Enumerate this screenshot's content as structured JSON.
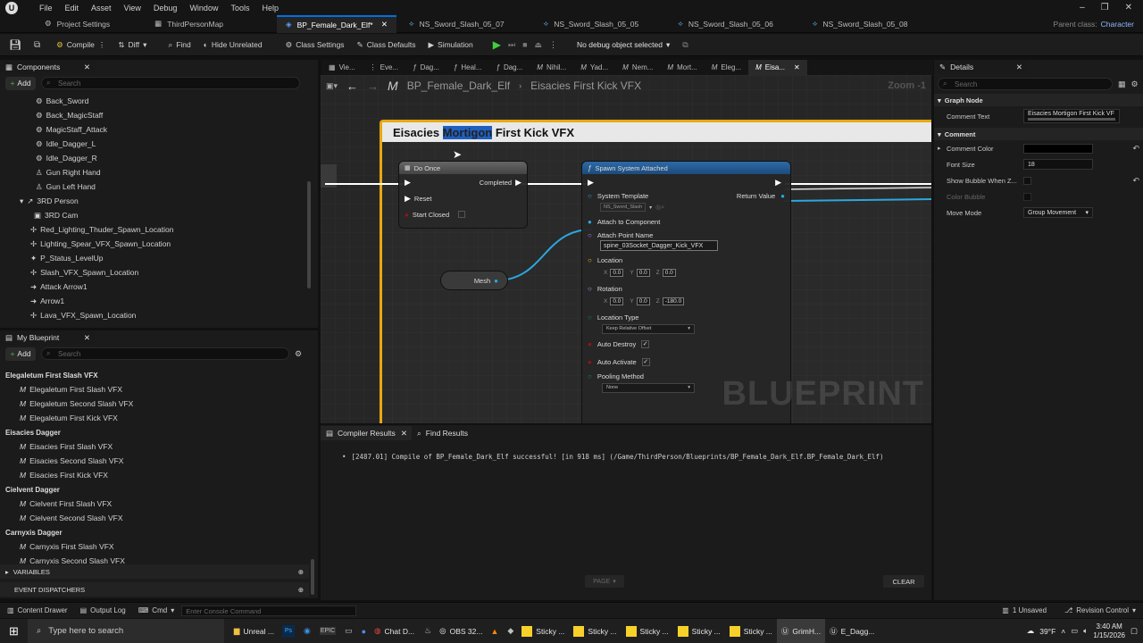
{
  "menu": [
    "File",
    "Edit",
    "Asset",
    "View",
    "Debug",
    "Window",
    "Tools",
    "Help"
  ],
  "doc_tabs": [
    {
      "label": "Project Settings"
    },
    {
      "label": "ThirdPersonMap"
    },
    {
      "label": "BP_Female_Dark_Elf*"
    },
    {
      "label": "NS_Sword_Slash_05_07"
    },
    {
      "label": "NS_Sword_Slash_05_05"
    },
    {
      "label": "NS_Sword_Slash_05_06"
    },
    {
      "label": "NS_Sword_Slash_05_08"
    }
  ],
  "parent_class": {
    "label": "Parent class:",
    "value": "Character"
  },
  "toolbar": {
    "compile": "Compile",
    "diff": "Diff",
    "find": "Find",
    "hide_unrelated": "Hide Unrelated",
    "class_settings": "Class Settings",
    "class_defaults": "Class Defaults",
    "simulation": "Simulation",
    "debug_object": "No debug object selected"
  },
  "components": {
    "title": "Components",
    "add": "Add",
    "search_placeholder": "Search",
    "items": [
      {
        "label": "Back_Sword"
      },
      {
        "label": "Back_MagicStaff"
      },
      {
        "label": "MagicStaff_Attack"
      },
      {
        "label": "Idle_Dagger_L"
      },
      {
        "label": "Idle_Dagger_R"
      },
      {
        "label": "Gun Right Hand"
      },
      {
        "label": "Gun Left Hand"
      },
      {
        "label": "3RD Person"
      },
      {
        "label": "3RD Cam"
      },
      {
        "label": "Red_Lighting_Thuder_Spawn_Location"
      },
      {
        "label": "Lighting_Spear_VFX_Spawn_Location"
      },
      {
        "label": "P_Status_LevelUp"
      },
      {
        "label": "Slash_VFX_Spawn_Location"
      },
      {
        "label": "Attack Arrow1"
      },
      {
        "label": "Arrow1"
      },
      {
        "label": "Lava_VFX_Spawn_Location"
      }
    ]
  },
  "my_blueprint": {
    "title": "My Blueprint",
    "add": "Add",
    "search_placeholder": "Search",
    "groups": [
      {
        "name": "Elegaletum First Slash VFX",
        "items": [
          "Elegaletum First Slash VFX",
          "Elegaletum Second Slash VFX",
          "Elegaletum First Kick VFX"
        ]
      },
      {
        "name": "Eisacies Dagger",
        "items": [
          "Eisacies First Slash VFX",
          "Eisacies Second Slash VFX",
          "Eisacies First Kick VFX"
        ]
      },
      {
        "name": "Cielvent Dagger",
        "items": [
          "Cielvent First Slash VFX",
          "Cielvent Second Slash VFX"
        ]
      },
      {
        "name": "Carnyxis Dagger",
        "items": [
          "Carnyxis First Slash VFX",
          "Carnyxis Second Slash VFX"
        ]
      }
    ],
    "variables": "VARIABLES",
    "event_dispatchers": "EVENT DISPATCHERS"
  },
  "graph_tabs": [
    "Vie...",
    "Eve...",
    "Dag...",
    "Heal...",
    "Dag...",
    "Nihil...",
    "Yad...",
    "Nem...",
    "Mort...",
    "Eleg...",
    "Eisa..."
  ],
  "breadcrumb": {
    "root": "BP_Female_Dark_Elf",
    "current": "Eisacies First Kick VFX",
    "zoom": "Zoom -1"
  },
  "comment_box": {
    "pre": "Eisacies ",
    "highlight": "Mortigon",
    "post": " First Kick VFX"
  },
  "do_once": {
    "title": "Do Once",
    "completed": "Completed",
    "reset": "Reset",
    "start_closed": "Start Closed"
  },
  "mesh_node": {
    "label": "Mesh"
  },
  "spawn_node": {
    "title": "Spawn System Attached",
    "system_template": "System Template",
    "template_value": "NS_Sword_Slash",
    "return_value": "Return Value",
    "attach_to_component": "Attach to Component",
    "attach_point_name": "Attach Point Name",
    "attach_point_value": "spine_03Socket_Dagger_Kick_VFX",
    "location": "Location",
    "loc": [
      "0.0",
      "0.0",
      "0.0"
    ],
    "rotation": "Rotation",
    "rot": [
      "0.0",
      "0.0",
      "-180.0"
    ],
    "location_type": "Location Type",
    "location_type_value": "Keep Relative Offset",
    "auto_destroy": "Auto Destroy",
    "auto_activate": "Auto Activate",
    "pooling_method": "Pooling Method",
    "pooling_value": "None",
    "axis": [
      "X",
      "Y",
      "Z"
    ]
  },
  "watermark": "BLUEPRINT",
  "details": {
    "title": "Details",
    "search_placeholder": "Search",
    "graph_node": "Graph Node",
    "comment_text_label": "Comment Text",
    "comment_text_value": "Eisacies Mortigon First Kick VF",
    "comment_section": "Comment",
    "comment_color": "Comment Color",
    "font_size_label": "Font Size",
    "font_size_value": "18",
    "show_bubble": "Show Bubble When Z...",
    "color_bubble": "Color Bubble",
    "move_mode": "Move Mode",
    "move_mode_value": "Group Movement",
    "comment_color_hex": "#000000"
  },
  "compiler": {
    "tab": "Compiler Results",
    "find_tab": "Find Results",
    "message": "[2487.01] Compile of BP_Female_Dark_Elf successful! [in 918 ms] (/Game/ThirdPerson/Blueprints/BP_Female_Dark_Elf.BP_Female_Dark_Elf)",
    "page": "PAGE",
    "clear": "CLEAR"
  },
  "statusbar": {
    "content_drawer": "Content Drawer",
    "output_log": "Output Log",
    "cmd": "Cmd",
    "console_placeholder": "Enter Console Command",
    "unsaved": "1 Unsaved",
    "revision": "Revision Control"
  },
  "taskbar": {
    "search": "Type here to search",
    "apps": [
      "Unreal ...",
      "Chat D...",
      "OBS 32...",
      "Sticky ...",
      "Sticky ...",
      "Sticky ...",
      "Sticky ...",
      "Sticky ...",
      "GrimH...",
      "E_Dagg..."
    ],
    "temp": "39°F",
    "time": "3:40 AM",
    "date": "1/15/2026"
  },
  "colors": {
    "accent": "#0070e0",
    "comment_border": "#e8a814",
    "exec": "#ffffff",
    "object_pin": "#2aa8e0",
    "highlight": "#1f5fbf"
  }
}
